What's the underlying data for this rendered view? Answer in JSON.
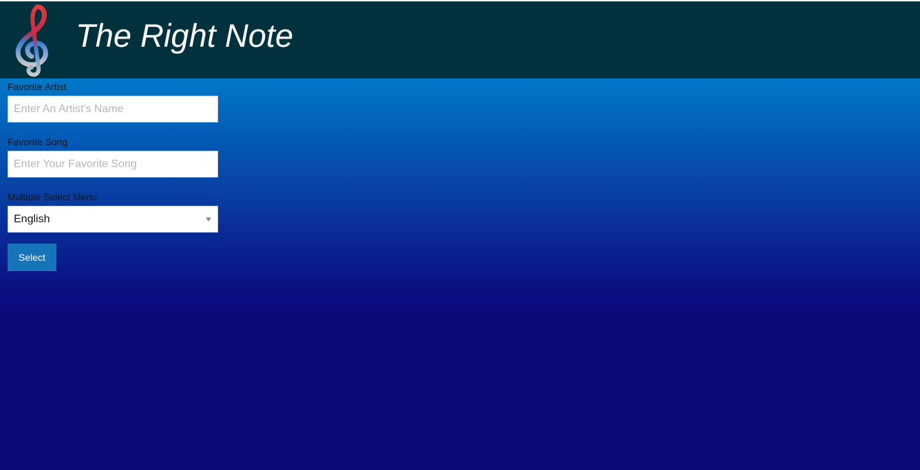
{
  "header": {
    "title": "The Right Note",
    "logo_icon": "treble-clef-icon"
  },
  "form": {
    "artist": {
      "label": "Favorite Artist",
      "placeholder": "Enter An Artist's Name",
      "value": ""
    },
    "song": {
      "label": "Favorite Song",
      "placeholder": "Enter Your Favorite Song",
      "value": ""
    },
    "menu": {
      "label": "Multiple Select Menu",
      "selected": "English"
    },
    "submit_label": "Select"
  },
  "colors": {
    "header_bg": "#00313d",
    "gradient_top": "#00a8e4",
    "gradient_bottom": "#0b087a",
    "button_bg": "#1675b9"
  }
}
